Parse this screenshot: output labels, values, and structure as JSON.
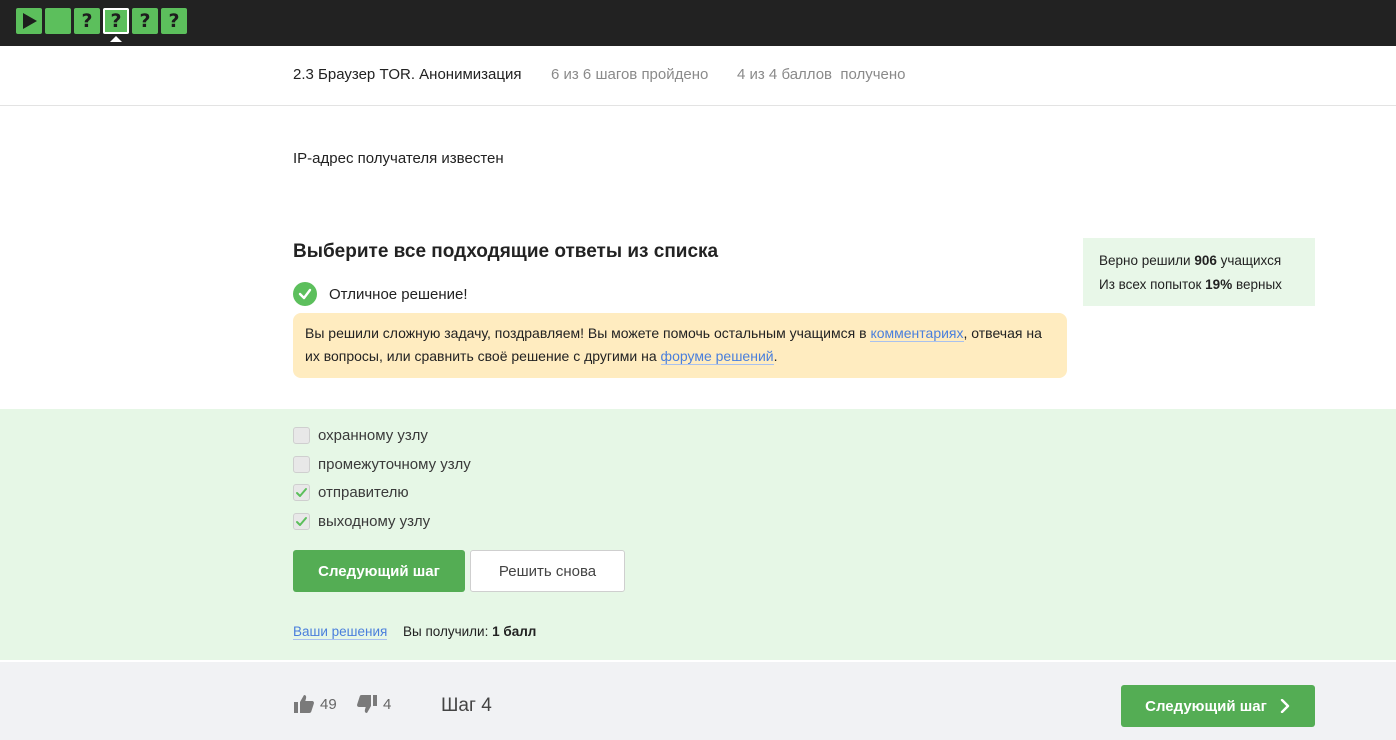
{
  "steps": [
    {
      "icon": "play-icon",
      "state": "passed"
    },
    {
      "icon": "text-step-icon",
      "state": "passed"
    },
    {
      "icon": "question-icon",
      "label": "?",
      "state": "passed"
    },
    {
      "icon": "question-icon",
      "label": "?",
      "state": "current"
    },
    {
      "icon": "question-icon",
      "label": "?",
      "state": "passed"
    },
    {
      "icon": "question-icon",
      "label": "?",
      "state": "passed"
    }
  ],
  "lesson": {
    "title": "2.3 Браузер TOR. Анонимизация",
    "progress": "6 из 6 шагов пройдено",
    "score": "4 из 4 баллов  получено"
  },
  "question": {
    "text": "IP-адрес получателя известен"
  },
  "quiz": {
    "title": "Выберите все подходящие ответы из списка",
    "result": "Отличное решение!",
    "hint": {
      "part1": "Вы решили сложную задачу, поздравляем! Вы можете помочь остальным учащимся в ",
      "link1": "комментариях",
      "part2": ", отвечая на их вопросы, или сравнить своё решение с другими на ",
      "link2": "форуме решений",
      "part3": "."
    },
    "options": [
      {
        "label": "охранному узлу",
        "checked": false
      },
      {
        "label": "промежуточному узлу",
        "checked": false
      },
      {
        "label": "отправителю",
        "checked": true
      },
      {
        "label": "выходному узлу",
        "checked": true
      }
    ],
    "next_button": "Следующий шаг",
    "retry_button": "Решить снова",
    "solutions_link": "Ваши решения",
    "score_prefix": "Вы получили:",
    "score_value": "1 балл"
  },
  "stats": {
    "solved_prefix": "Верно решили",
    "solved_count": "906",
    "solved_suffix": "учащихся",
    "attempts_prefix": "Из всех попыток",
    "attempts_percent": "19%",
    "attempts_suffix": "верных"
  },
  "footer": {
    "likes": "49",
    "dislikes": "4",
    "step_label": "Шаг 4",
    "next_button": "Следующий шаг"
  },
  "colors": {
    "accent_green": "#54ad54",
    "success_bg": "#e6f7e6",
    "hint_bg": "#ffecc0",
    "link": "#4a7fdc"
  }
}
